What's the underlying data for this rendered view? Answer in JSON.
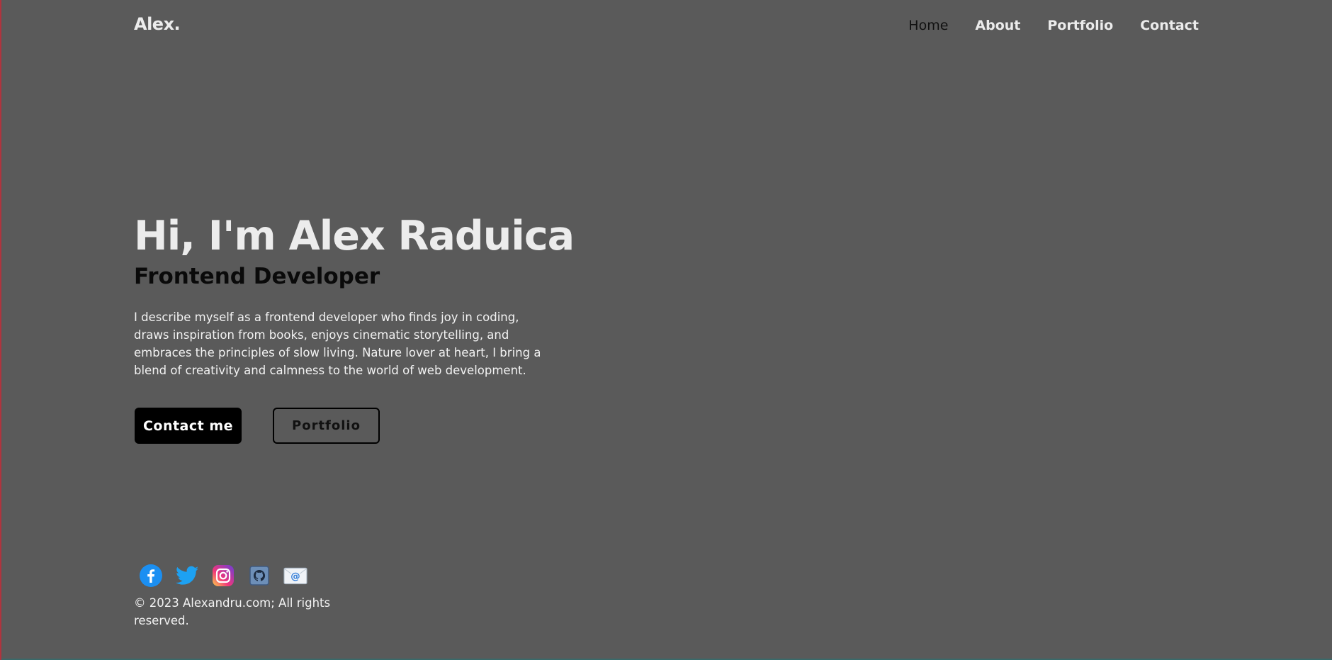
{
  "header": {
    "logo": "Alex.",
    "nav": [
      {
        "label": "Home",
        "active": true
      },
      {
        "label": "About",
        "active": false
      },
      {
        "label": "Portfolio",
        "active": false
      },
      {
        "label": "Contact",
        "active": false
      }
    ]
  },
  "hero": {
    "title": "Hi, I'm Alex Raduica",
    "subtitle": "Frontend Developer",
    "description": "I describe myself as a frontend developer who finds joy in coding, draws inspiration from books, enjoys cinematic storytelling, and embraces the principles of slow living. Nature lover at heart, I bring a blend of creativity and calmness to the world of web development.",
    "primary_button": "Contact me",
    "secondary_button": "Portfolio"
  },
  "footer": {
    "socials": [
      {
        "icon": "facebook-icon"
      },
      {
        "icon": "twitter-icon"
      },
      {
        "icon": "instagram-icon"
      },
      {
        "icon": "github-icon"
      },
      {
        "icon": "email-icon"
      }
    ],
    "copyright": "© 2023 Alexandru.com; All rights reserved."
  },
  "colors": {
    "background": "#5a5a5a",
    "text_light": "#ececec",
    "text_dark": "#0a0a0a",
    "button_primary": "#000000"
  }
}
